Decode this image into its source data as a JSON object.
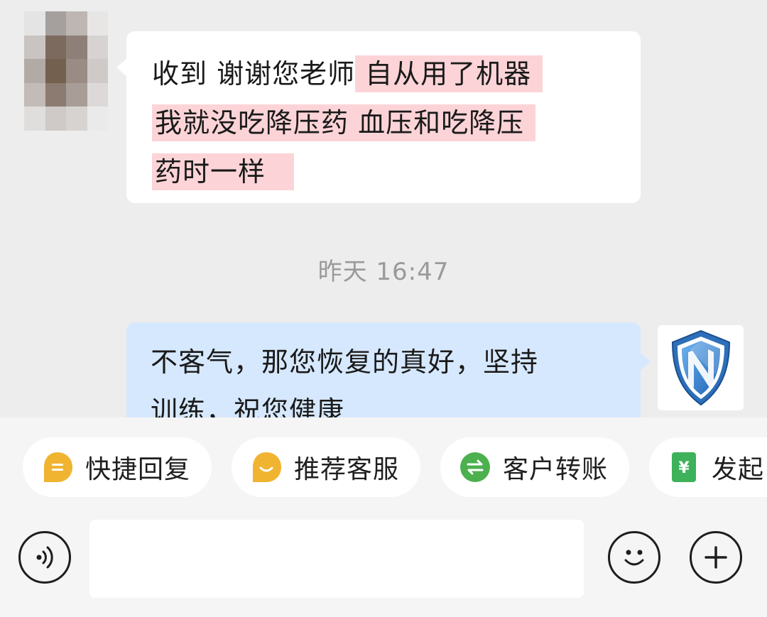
{
  "messages": {
    "incoming": {
      "plain_text": "收到  谢谢您老师",
      "highlight_line1": "自从用了机器",
      "highlight_line2": "我就没吃降压药  血压和吃降压",
      "highlight_line3": "药时一样"
    },
    "timestamp": "昨天  16:47",
    "outgoing": {
      "line1": "不客气，那您恢复的真好，坚持",
      "line2": "训练，祝您健康"
    }
  },
  "quick_actions": [
    {
      "label": "快捷回复",
      "icon": "quick-reply-icon",
      "color": "#f0b431"
    },
    {
      "label": "推荐客服",
      "icon": "recommend-service-icon",
      "color": "#f0b431"
    },
    {
      "label": "客户转账",
      "icon": "transfer-icon",
      "color": "#4cb04f"
    },
    {
      "label": "发起",
      "icon": "yuan-payment-icon",
      "color": "#3db25a"
    }
  ],
  "input": {
    "placeholder": "",
    "value": ""
  },
  "colors": {
    "background": "#ededed",
    "incoming_bubble": "#ffffff",
    "outgoing_bubble": "#d6e8fd",
    "highlight": "#fcd4d7",
    "timestamp_text": "#9a9a9a"
  },
  "icons": {
    "voice": "voice-icon",
    "emoji": "emoji-icon",
    "plus": "plus-icon",
    "shield_avatar": "shield-logo-icon"
  }
}
